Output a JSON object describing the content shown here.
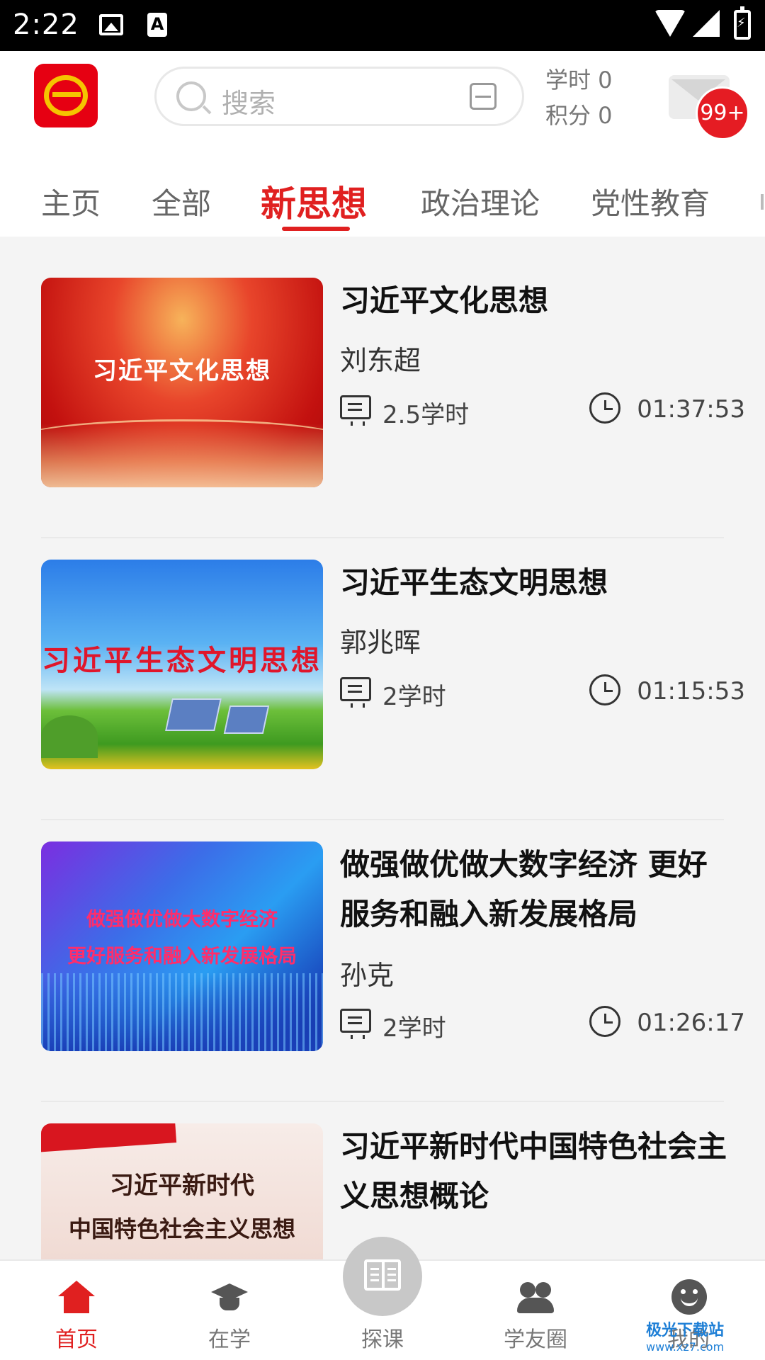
{
  "status_bar": {
    "time": "2:22"
  },
  "header": {
    "search_placeholder": "搜索",
    "study_hours_label": "学时 0",
    "points_label": "积分 0",
    "message_badge": "99+"
  },
  "tabs": [
    {
      "label": "主页",
      "active": false
    },
    {
      "label": "全部",
      "active": false
    },
    {
      "label": "新思想",
      "active": true
    },
    {
      "label": "政治理论",
      "active": false
    },
    {
      "label": "党性教育",
      "active": false
    }
  ],
  "courses": [
    {
      "title": "习近平文化思想",
      "thumb_text": "习近平文化思想",
      "author": "刘东超",
      "hours": "2.5学时",
      "duration": "01:37:53"
    },
    {
      "title": "习近平生态文明思想",
      "thumb_text": "习近平生态文明思想",
      "author": "郭兆晖",
      "hours": "2学时",
      "duration": "01:15:53"
    },
    {
      "title": "做强做优做大数字经济 更好服务和融入新发展格局",
      "thumb_text_line1": "做强做优做大数字经济",
      "thumb_text_line2": "更好服务和融入新发展格局",
      "author": "孙克",
      "hours": "2学时",
      "duration": "01:26:17"
    },
    {
      "title": "习近平新时代中国特色社会主义思想概论",
      "thumb_text_line1": "习近平新时代",
      "thumb_text_line2": "中国特色社会主义思想"
    }
  ],
  "bottom_nav": [
    {
      "label": "首页",
      "icon": "home-icon",
      "active": true
    },
    {
      "label": "在学",
      "icon": "graduation-cap-icon",
      "active": false
    },
    {
      "label": "探课",
      "icon": "book-icon",
      "active": false
    },
    {
      "label": "学友圈",
      "icon": "people-icon",
      "active": false
    },
    {
      "label": "我的",
      "icon": "smiley-icon",
      "active": false
    }
  ],
  "watermark": {
    "text": "极光下载站",
    "url": "www.xz7.com"
  },
  "colors": {
    "accent": "#e02020",
    "badge": "#e51c23",
    "logo_bg": "#e60012",
    "logo_fg": "#f5c400"
  }
}
